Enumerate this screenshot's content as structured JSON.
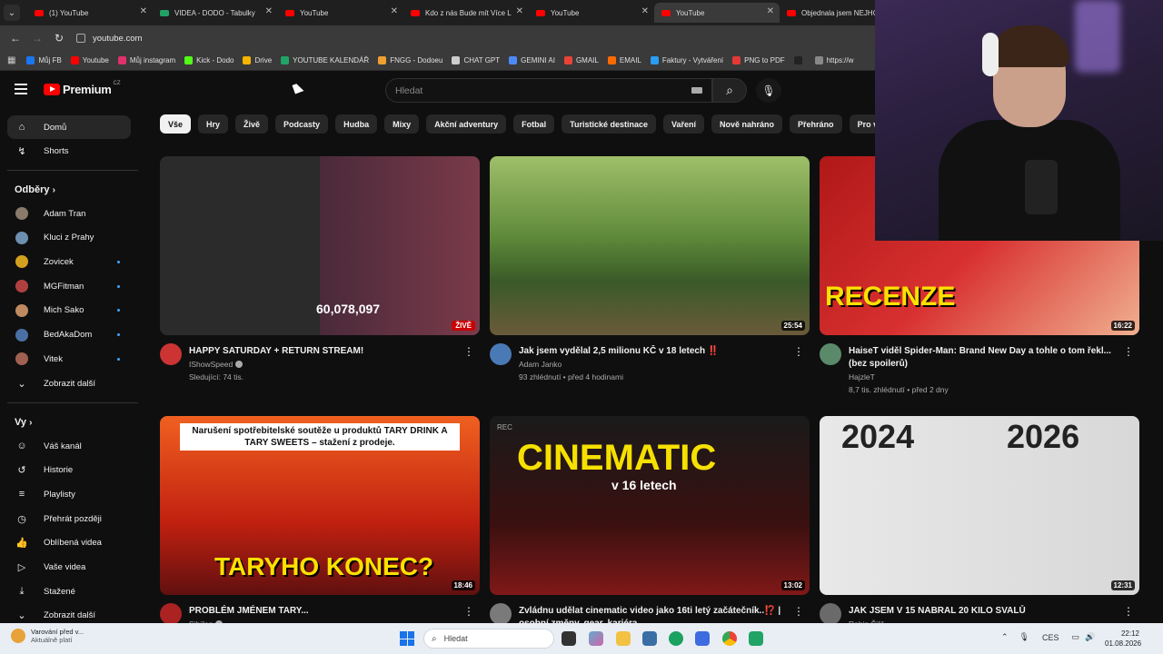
{
  "browser": {
    "tabs": [
      {
        "label": "(1) YouTube",
        "icon": "youtube-icon",
        "active": false
      },
      {
        "label": "VIDEA - DODO - Tabulky",
        "icon": "sheets-icon",
        "active": false
      },
      {
        "label": "YouTube",
        "icon": "youtube-icon",
        "active": false
      },
      {
        "label": "Kdo z nás Bude mít Více L",
        "icon": "youtube-icon",
        "active": false
      },
      {
        "label": "YouTube",
        "icon": "youtube-icon",
        "active": false
      },
      {
        "label": "YouTube",
        "icon": "youtube-icon",
        "active": true
      },
      {
        "label": "Objednala jsem NEJHOR",
        "icon": "youtube-icon",
        "active": false
      }
    ],
    "url": "youtube.com",
    "bookmarks": [
      {
        "label": "Můj FB",
        "color": "#1877f2"
      },
      {
        "label": "Youtube",
        "color": "#ff0000"
      },
      {
        "label": "Můj instagram",
        "color": "#e1306c"
      },
      {
        "label": "Kick - Dodo",
        "color": "#53fc18"
      },
      {
        "label": "Drive",
        "color": "#f4b400"
      },
      {
        "label": "YOUTUBE KALENDÁŘ",
        "color": "#21a366"
      },
      {
        "label": "FNGG - Dodoeu",
        "color": "#f0a030"
      },
      {
        "label": "CHAT GPT",
        "color": "#cccccc"
      },
      {
        "label": "GEMINI AI",
        "color": "#4c8bf5"
      },
      {
        "label": "GMAIL",
        "color": "#ea4335"
      },
      {
        "label": "EMAIL",
        "color": "#ff6a00"
      },
      {
        "label": "Faktury - Vytváření",
        "color": "#2a9df4"
      },
      {
        "label": "PNG to PDF",
        "color": "#e53935"
      },
      {
        "label": "",
        "color": "#222222"
      },
      {
        "label": "https://w",
        "color": "#888888"
      }
    ]
  },
  "youtube": {
    "logo_text": "Premium",
    "region": "CZ",
    "search_placeholder": "Hledat",
    "sidebar": {
      "home": "Domů",
      "shorts": "Shorts",
      "subscriptions_title": "Odběry",
      "subscriptions": [
        {
          "label": "Adam Tran",
          "color": "#8a7a6a",
          "new": false
        },
        {
          "label": "Kluci z Prahy",
          "color": "#6d8fb0",
          "new": false
        },
        {
          "label": "Zovicek",
          "color": "#d4a020",
          "new": true
        },
        {
          "label": "MGFitman",
          "color": "#b04040",
          "new": true
        },
        {
          "label": "Mich Sako",
          "color": "#c08a60",
          "new": true
        },
        {
          "label": "BedAkaDom",
          "color": "#4a6fa5",
          "new": true
        },
        {
          "label": "Vitek",
          "color": "#a06050",
          "new": true
        }
      ],
      "show_more": "Zobrazit další",
      "you_title": "Vy",
      "you_items": [
        {
          "label": "Váš kanál",
          "icon": "channel-icon"
        },
        {
          "label": "Historie",
          "icon": "history-icon"
        },
        {
          "label": "Playlisty",
          "icon": "playlist-icon"
        },
        {
          "label": "Přehrát později",
          "icon": "clock-icon"
        },
        {
          "label": "Oblíbená videa",
          "icon": "like-icon"
        },
        {
          "label": "Vaše videa",
          "icon": "video-icon"
        },
        {
          "label": "Stažené",
          "icon": "download-icon"
        },
        {
          "label": "Zobrazit další",
          "icon": "chevron-down-icon"
        }
      ]
    },
    "chips": [
      "Vše",
      "Hry",
      "Živě",
      "Podcasty",
      "Hudba",
      "Mixy",
      "Akční adventury",
      "Fotbal",
      "Turistické destinace",
      "Vaření",
      "Nově nahráno",
      "Přehráno",
      "Pro vás nové"
    ],
    "videos": [
      {
        "title": "HAPPY SATURDAY + RETURN STREAM!",
        "channel": "IShowSpeed",
        "verified": true,
        "stats": "Sledující: 74 tis.",
        "duration": "",
        "live_badge": "ŽIVĚ",
        "thumb_text": "60,078,097",
        "avatar": "#cc3333",
        "thumb_bg": "linear-gradient(90deg,#2b2b2b 0%,#2b2b2b 50%,#4a2a3a 50%,#7a3a4a 100%)",
        "thumb_color": "#ffffff"
      },
      {
        "title": "Jak jsem vydělal 2,5 milionu KČ v 18 letech ‼️",
        "channel": "Adam Janko",
        "verified": false,
        "stats": "93 zhlédnutí • před 4 hodinami",
        "duration": "25:54",
        "live_badge": "",
        "thumb_text": "",
        "avatar": "#4a7ab5",
        "thumb_bg": "linear-gradient(180deg,#9fbf6a 0%,#5f8a3a 45%,#3a5a28 70%,#6a5a3a 100%)",
        "thumb_color": "#ffffff"
      },
      {
        "title": "HaiseT viděl Spider-Man: Brand New Day a tohle o tom řekl... (bez spoilerů)",
        "channel": "HajzleT",
        "verified": false,
        "stats": "8,7 tis. zhlédnutí • před 2 dny",
        "duration": "16:22",
        "live_badge": "",
        "thumb_text": "RECENZE",
        "avatar": "#5a8a6a",
        "thumb_bg": "linear-gradient(135deg,#b01818 0%,#d83030 50%,#f0b090 100%)",
        "thumb_color": "#ffe000"
      },
      {
        "title": "PROBLÉM JMÉNEM TARY...",
        "channel": "Sibiřan",
        "verified": true,
        "stats": "",
        "duration": "18:46",
        "live_badge": "",
        "thumb_text": "TARYHO KONEC?",
        "thumb_caption": "Narušení spotřebitelské soutěže u produktů TARY DRINK A TARY SWEETS – stažení z prodeje.",
        "avatar": "#aa2222",
        "thumb_bg": "linear-gradient(180deg,#f06020 0%,#c02010 60%,#601010 100%)",
        "thumb_color": "#ffe000"
      },
      {
        "title": "Zvládnu udělat cinematic video jako 16ti letý začátečník..⁉️ | osobní změny, gear, kariéra...",
        "channel": "",
        "verified": false,
        "stats": "",
        "duration": "13:02",
        "live_badge": "REC",
        "thumb_text": "CINEMATIC",
        "thumb_sub": "v 16 letech",
        "avatar": "#7a7a7a",
        "thumb_bg": "linear-gradient(180deg,#1a1a1a 0%,#3a1010 60%,#801818 100%)",
        "thumb_color": "#f5e000"
      },
      {
        "title": "JAK JSEM V 15 NABRAL 20 KILO SVALŮ",
        "channel": "Robin Šiřč",
        "verified": false,
        "stats": "",
        "duration": "12:31",
        "live_badge": "",
        "thumb_text": "2024",
        "thumb_text2": "2026",
        "avatar": "#6a6a6a",
        "thumb_bg": "linear-gradient(90deg,#e8e8e8 0%,#d8d8d8 100%)",
        "thumb_color": "#222222"
      }
    ]
  },
  "taskbar": {
    "weather_line1": "Varování před v...",
    "weather_line2": "Aktuálně platí",
    "search": "Hledat",
    "lang": "CES",
    "time": "22:12",
    "date": "01.08.2026"
  }
}
